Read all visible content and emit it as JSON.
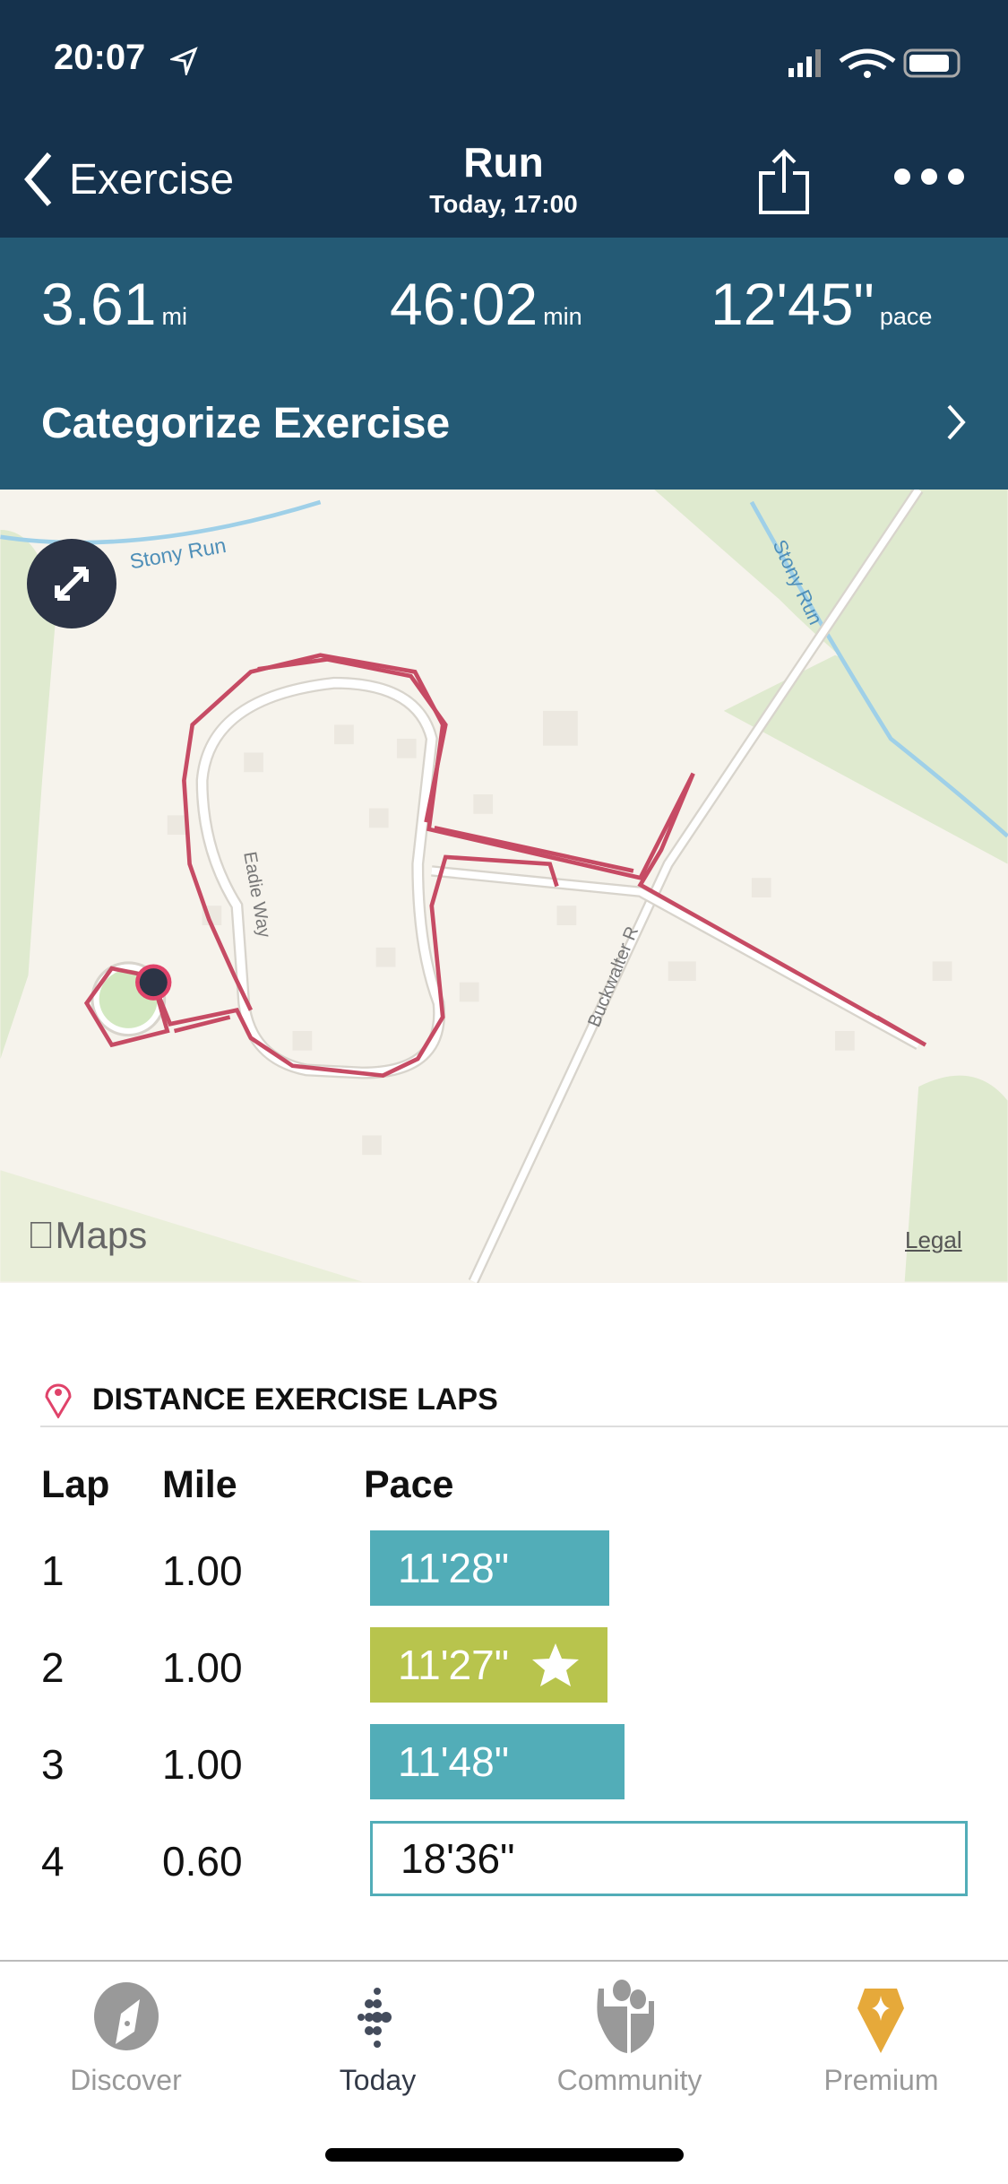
{
  "status_bar": {
    "time": "20:07"
  },
  "nav": {
    "back_label": "Exercise",
    "title": "Run",
    "subtitle": "Today, 17:00"
  },
  "stats": {
    "distance": "3.61",
    "distance_unit": "mi",
    "duration": "46:02",
    "duration_unit": "min",
    "pace": "12'45\"",
    "pace_unit": "pace"
  },
  "categorize_label": "Categorize Exercise",
  "map": {
    "labels": {
      "stream1": "Stony Run",
      "stream2": "Stony Run",
      "street1": "Eadie Way",
      "street2": "Buckwalter R"
    },
    "attribution": "Maps",
    "legal": "Legal",
    "route_color": "#c64b64"
  },
  "laps": {
    "section_title": "DISTANCE EXERCISE LAPS",
    "headers": {
      "lap": "Lap",
      "mile": "Mile",
      "pace": "Pace"
    },
    "rows": [
      {
        "lap": "1",
        "mile": "1.00",
        "pace": "11'28\"",
        "color": "#52adb8",
        "best": false
      },
      {
        "lap": "2",
        "mile": "1.00",
        "pace": "11'27\"",
        "color": "#b8c44d",
        "best": true
      },
      {
        "lap": "3",
        "mile": "1.00",
        "pace": "11'48\"",
        "color": "#52adb8",
        "best": false
      },
      {
        "lap": "4",
        "mile": "0.60",
        "pace": "18'36\"",
        "color": "#ffffff",
        "best": false
      }
    ]
  },
  "tabs": [
    {
      "label": "Discover",
      "icon": "compass-icon"
    },
    {
      "label": "Today",
      "icon": "fitbit-dots-icon",
      "active": true
    },
    {
      "label": "Community",
      "icon": "community-icon"
    },
    {
      "label": "Premium",
      "icon": "premium-gem-icon",
      "color": "#e6a93a"
    }
  ]
}
